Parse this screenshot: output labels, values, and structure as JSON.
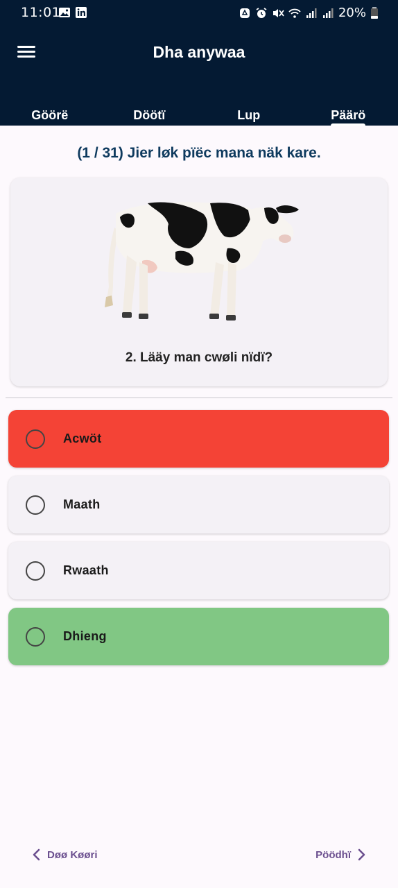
{
  "status_bar": {
    "time": "11:01",
    "battery": "20%",
    "icons": [
      "gallery-icon",
      "linkedin-icon",
      "recycle-icon",
      "alarm-icon",
      "mute-icon",
      "wifi-icon",
      "signal-icon",
      "signal-icon",
      "battery-icon"
    ]
  },
  "app_bar": {
    "title": "Dha anywaa",
    "menu_icon": "menu-icon"
  },
  "tabs": [
    {
      "label": "Göörë",
      "active": false
    },
    {
      "label": "Döötï",
      "active": false
    },
    {
      "label": "Lup",
      "active": false
    },
    {
      "label": "Päärö",
      "active": true
    }
  ],
  "quiz": {
    "header": "(1 / 31) Jier løk pïëc mana näk kare.",
    "question": "2. Lääy man cwøli nïdï?",
    "image": "cow-illustration",
    "options": [
      {
        "label": "Acwöt",
        "state": "wrong"
      },
      {
        "label": "Maath",
        "state": "neutral"
      },
      {
        "label": "Rwaath",
        "state": "neutral"
      },
      {
        "label": "Dhieng",
        "state": "correct"
      }
    ],
    "colors": {
      "wrong": "#f44336",
      "correct": "#81c784",
      "neutral": "#f4f1f6"
    }
  },
  "navigation": {
    "prev_label": "Døø Køøri",
    "next_label": "Pöödhï"
  },
  "colors": {
    "app_bar": "#041a33",
    "header_text": "#0e3a5e",
    "nav_accent": "#6b4f8f"
  }
}
